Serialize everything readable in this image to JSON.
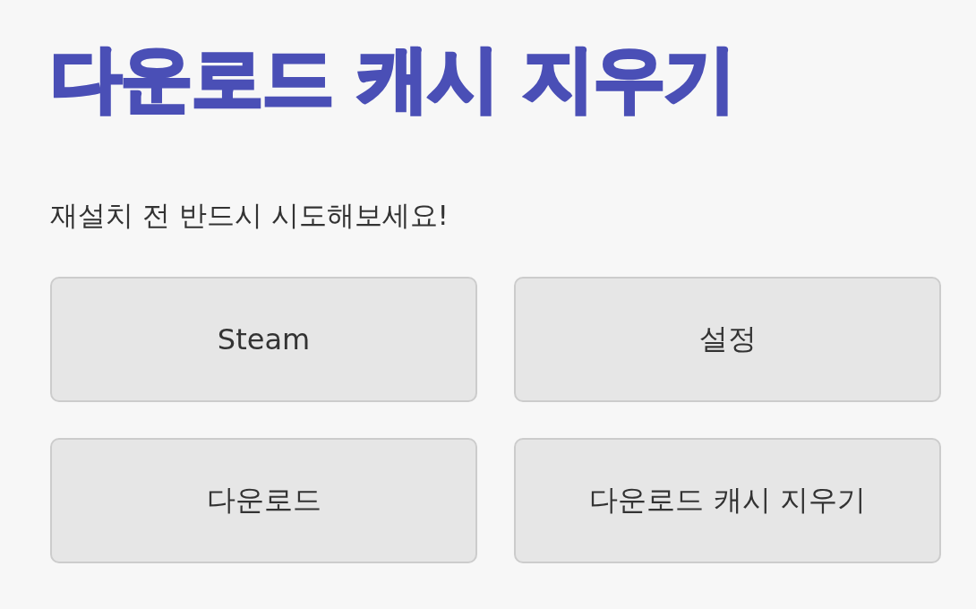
{
  "title": "다운로드 캐시 지우기",
  "subtitle": "재설치 전 반드시 시도해보세요!",
  "buttons": [
    {
      "label": "Steam"
    },
    {
      "label": "설정"
    },
    {
      "label": "다운로드"
    },
    {
      "label": "다운로드 캐시 지우기"
    }
  ]
}
